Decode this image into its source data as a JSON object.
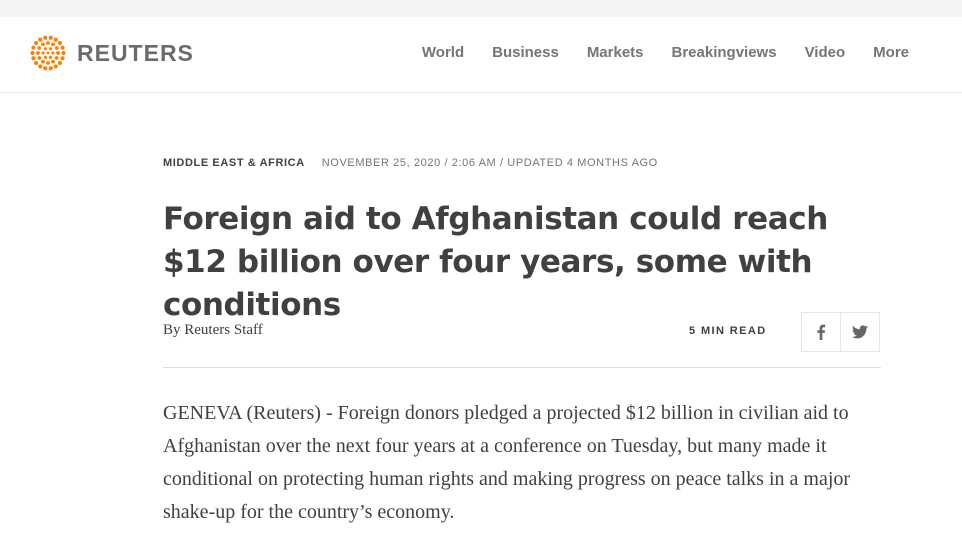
{
  "brand": {
    "name": "REUTERS",
    "accent": "#ff8000"
  },
  "nav": {
    "items": [
      "World",
      "Business",
      "Markets",
      "Breakingviews",
      "Video",
      "More"
    ]
  },
  "article": {
    "section": "MIDDLE EAST & AFRICA",
    "dateline": "NOVEMBER 25, 2020 / 2:06 AM / UPDATED 4 MONTHS AGO",
    "headline": "Foreign aid to Afghanistan could reach $12 billion over four years, some with conditions",
    "byline_prefix": "By",
    "author": "Reuters Staff",
    "read_time": "5 MIN READ",
    "share": {
      "facebook_icon": "facebook-icon",
      "twitter_icon": "twitter-icon"
    },
    "body": "GENEVA (Reuters) - Foreign donors pledged a projected $12 billion in civilian aid to Afghanistan over the next four years at a conference on Tuesday, but many made it conditional on protecting human rights and making progress on peace talks in a major shake-up for the country’s economy."
  }
}
